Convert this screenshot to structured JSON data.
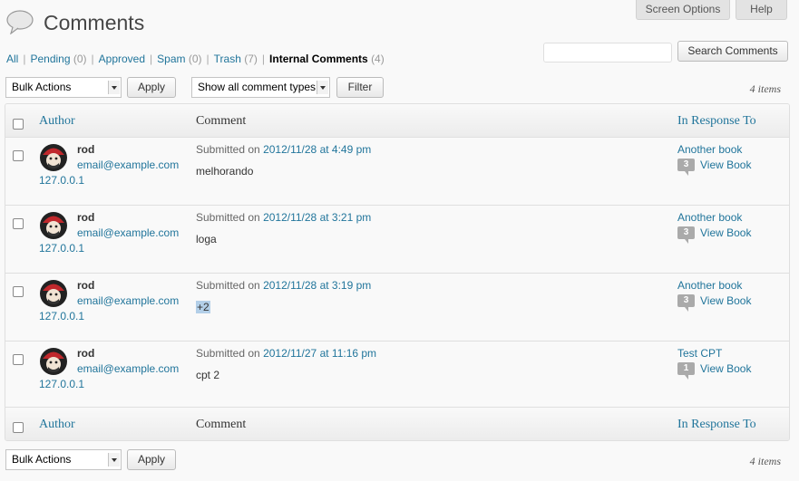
{
  "header": {
    "title": "Comments",
    "screen_options": "Screen Options",
    "help": "Help"
  },
  "filters": [
    {
      "label": "All",
      "count": ""
    },
    {
      "label": "Pending",
      "count": "(0)"
    },
    {
      "label": "Approved",
      "count": ""
    },
    {
      "label": "Spam",
      "count": "(0)"
    },
    {
      "label": "Trash",
      "count": "(7)"
    },
    {
      "label": "Internal Comments",
      "count": "(4)"
    }
  ],
  "search": {
    "button": "Search Comments",
    "value": ""
  },
  "tablenav_top": {
    "bulk_actions": "Bulk Actions",
    "apply": "Apply",
    "comment_type": "Show all comment types",
    "filter": "Filter",
    "items": "4 items"
  },
  "tablenav_bottom": {
    "bulk_actions": "Bulk Actions",
    "apply": "Apply",
    "items": "4 items"
  },
  "columns": {
    "author": "Author",
    "comment": "Comment",
    "response": "In Response To"
  },
  "submitted_prefix": "Submitted on",
  "rows": [
    {
      "author": "rod",
      "email": "email@example.com",
      "ip": "127.0.0.1",
      "date": "2012/11/28 at 4:49 pm",
      "text": "melhorando",
      "response_title": "Another book",
      "count": "3",
      "view": "View Book"
    },
    {
      "author": "rod",
      "email": "email@example.com",
      "ip": "127.0.0.1",
      "date": "2012/11/28 at 3:21 pm",
      "text": "loga",
      "response_title": "Another book",
      "count": "3",
      "view": "View Book"
    },
    {
      "author": "rod",
      "email": "email@example.com",
      "ip": "127.0.0.1",
      "date": "2012/11/28 at 3:19 pm",
      "text": "+2",
      "response_title": "Another book",
      "count": "3",
      "view": "View Book"
    },
    {
      "author": "rod",
      "email": "email@example.com",
      "ip": "127.0.0.1",
      "date": "2012/11/27 at 11:16 pm",
      "text": "cpt 2",
      "response_title": "Test CPT",
      "count": "1",
      "view": "View Book"
    }
  ],
  "colors": {
    "link": "#21759b",
    "highlight": "#b3cfe8"
  }
}
